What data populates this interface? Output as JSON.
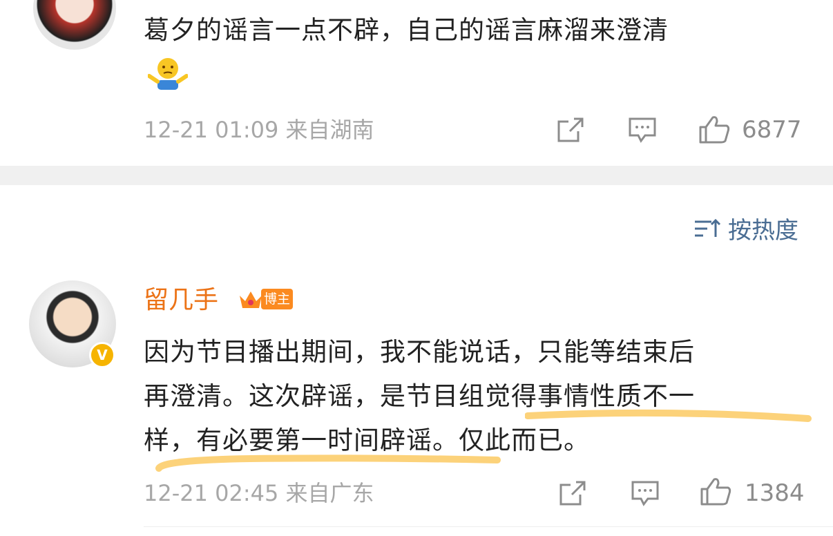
{
  "comment1": {
    "text": "葛夕的谣言一点不辟，自己的谣言麻溜来澄清",
    "emoji_icon": "shrug-icon",
    "time": "12-21 01:09",
    "location": "来自湖南",
    "like_count": "6877"
  },
  "sort_label": "按热度",
  "comment2": {
    "username": "留几手",
    "badge": "博主",
    "verified_mark": "V",
    "text_line1": "因为节目播出期间，我不能说话，只能等结束后",
    "text_line2a": "再澄清。这次辟谣，是节目",
    "text_line2b": "组觉得事情性质不一",
    "text_line3a": "样，",
    "text_line3b": "有必要第一时间辟谣。",
    "text_line3c": "仅此而已。",
    "time": "12-21 02:45",
    "location": "来自广东",
    "like_count": "1384"
  },
  "colors": {
    "username": "#ec7317",
    "highlight": "#fcd27a",
    "meta": "#a7a7a7",
    "sort": "#4a6d93"
  }
}
